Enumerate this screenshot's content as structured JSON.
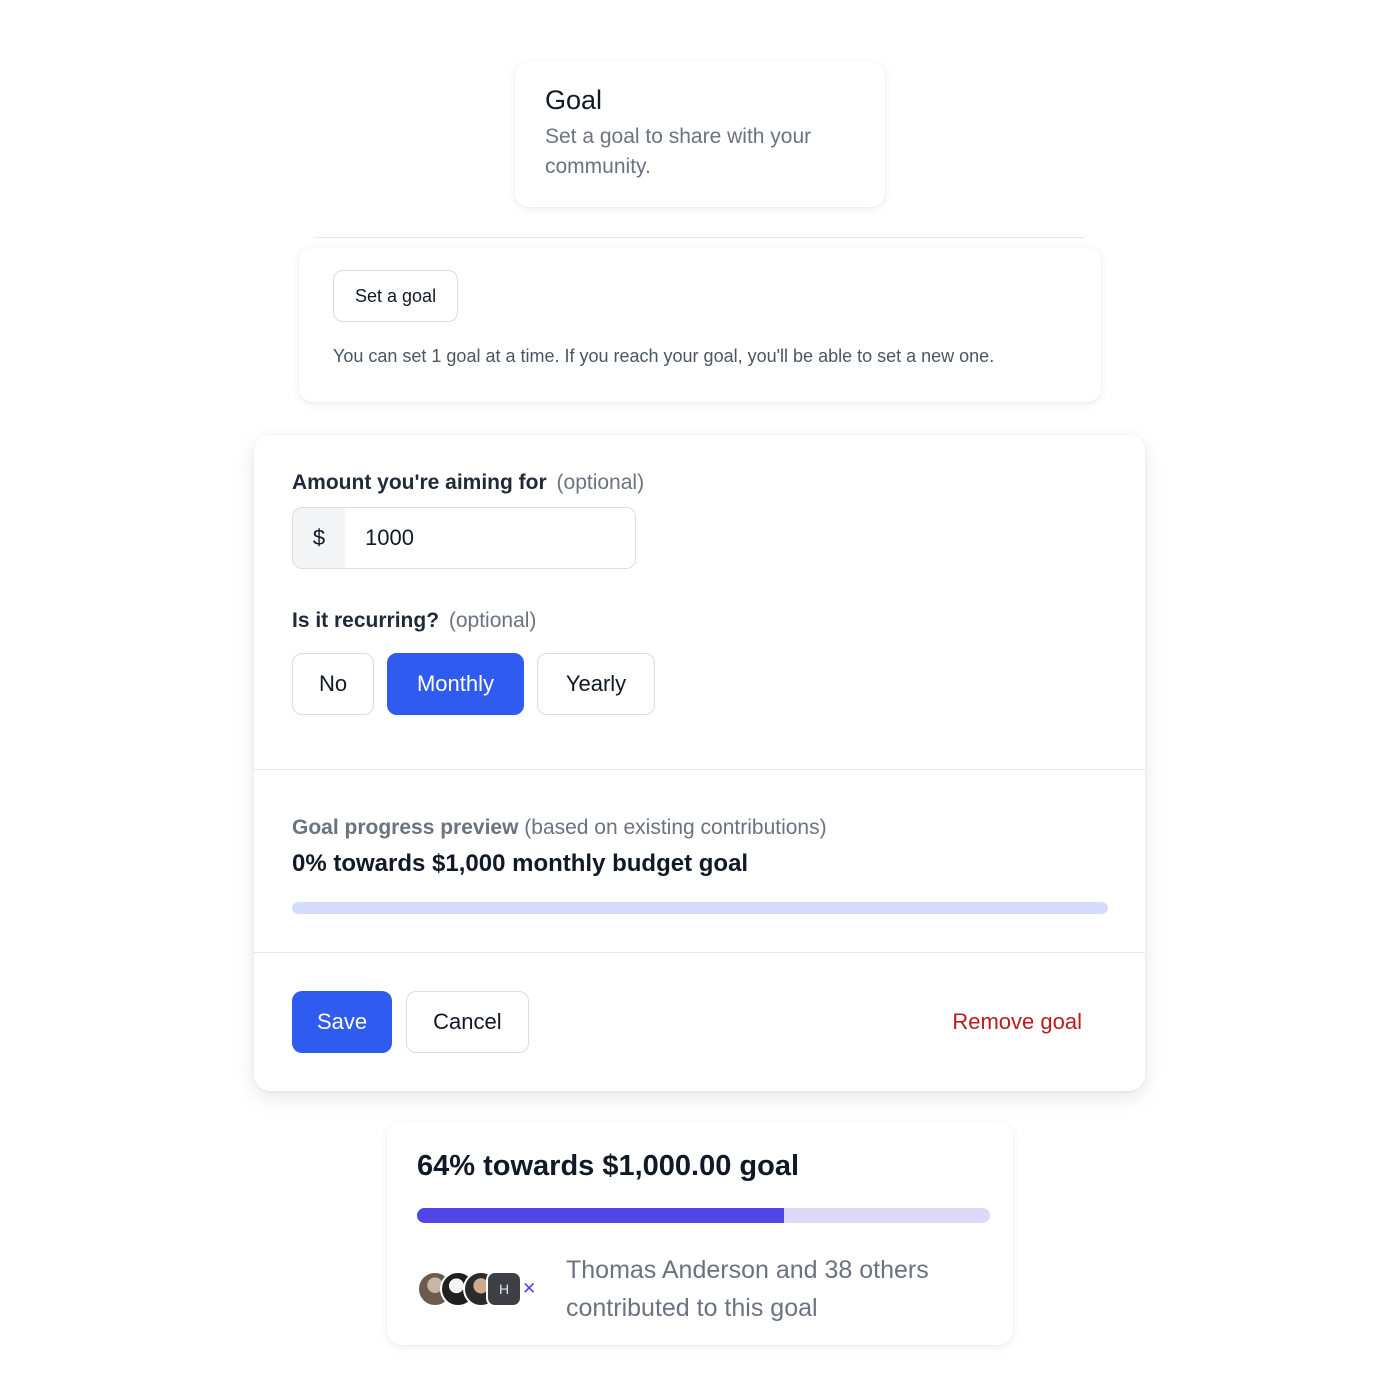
{
  "header": {
    "title": "Goal",
    "subtitle": "Set a goal to share with your community."
  },
  "set_goal": {
    "button_label": "Set a goal",
    "note": "You can set 1 goal at a time. If you reach your goal, you'll be able to set a new one."
  },
  "form": {
    "amount_label": "Amount you're aiming for",
    "amount_optional": "(optional)",
    "currency_symbol": "$",
    "amount_value": "1000",
    "recurring_label": "Is it recurring?",
    "recurring_optional": "(optional)",
    "recurring_options": [
      "No",
      "Monthly",
      "Yearly"
    ],
    "recurring_selected": "Monthly",
    "preview_label": "Goal progress preview",
    "preview_note": "(based on existing contributions)",
    "preview_title": "0% towards $1,000 monthly budget goal",
    "preview_progress": 0,
    "save_label": "Save",
    "cancel_label": "Cancel",
    "remove_label": "Remove goal"
  },
  "progress_card": {
    "title": "64% towards $1,000.00 goal",
    "progress": 0.64,
    "avatar_initial": "H",
    "avatar_mark": "✕",
    "contributors_text": "Thomas Anderson and 38 others contributed to this goal"
  },
  "colors": {
    "accent": "#2f5bf0",
    "progress_accent": "#4f46e5",
    "danger": "#b91c1c",
    "muted_text": "#6b7280"
  }
}
